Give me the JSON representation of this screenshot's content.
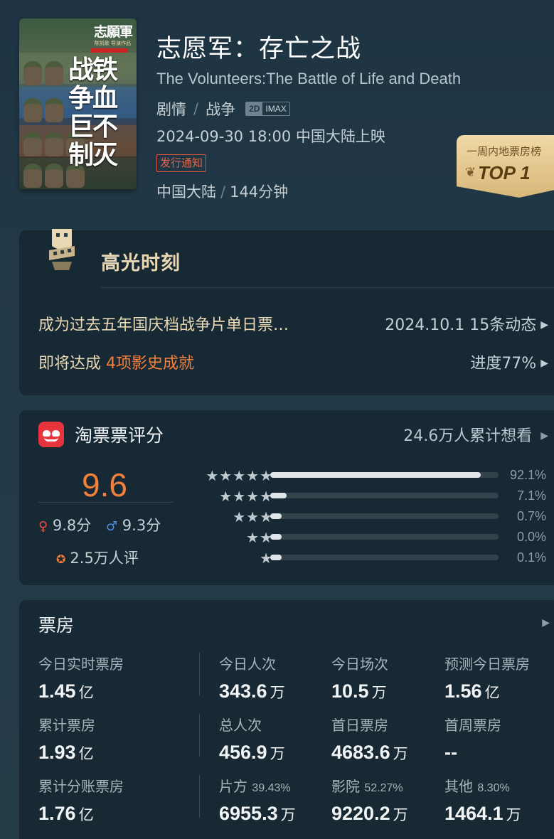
{
  "movie": {
    "poster": {
      "brand": "志願軍",
      "subtitle": "陈凯歌 导演作品",
      "title": "战铁\n争血\n巨不\n制灭"
    },
    "title_cn": "志愿军：存亡之战",
    "title_en": "The Volunteers:The Battle of Life and Death",
    "genres": [
      "剧情",
      "战争"
    ],
    "formats": [
      "2D",
      "IMAX"
    ],
    "release": "2024-09-30 18:00 中国大陆上映",
    "notice_label": "发行通知",
    "region": "中国大陆",
    "duration": "144分钟",
    "rank": {
      "label": "一周内地票房榜",
      "value": "TOP 1"
    }
  },
  "highlights": {
    "title": "高光时刻",
    "row1_text": "成为过去五年国庆档战争片单日票…",
    "row1_date": "2024.10.1",
    "row1_count": "15条动态",
    "row2_prefix": "即将达成",
    "row2_highlight": "4项影史成就",
    "row2_progress": "进度77%"
  },
  "rating": {
    "title": "淘票票评分",
    "want": "24.6万人累计想看",
    "score": "9.6",
    "female_score": "9.8分",
    "male_score": "9.3分",
    "count": "2.5万人评",
    "distribution": [
      {
        "stars": "★★★★★",
        "pct_label": "92.1%",
        "pct": 92.1
      },
      {
        "stars": "★★★★",
        "pct_label": "7.1%",
        "pct": 7.1
      },
      {
        "stars": "★★★",
        "pct_label": "0.7%",
        "pct": 0.7
      },
      {
        "stars": "★★",
        "pct_label": "0.0%",
        "pct": 0.0
      },
      {
        "stars": "★",
        "pct_label": "0.1%",
        "pct": 0.1
      }
    ]
  },
  "box_office": {
    "title": "票房",
    "rows": [
      [
        {
          "label": "今日实时票房",
          "value": "1.45",
          "unit": "亿"
        },
        {
          "label": "今日人次",
          "value": "343.6",
          "unit": "万"
        },
        {
          "label": "今日场次",
          "value": "10.5",
          "unit": "万"
        },
        {
          "label": "预测今日票房",
          "value": "1.56",
          "unit": "亿"
        }
      ],
      [
        {
          "label": "累计票房",
          "value": "1.93",
          "unit": "亿"
        },
        {
          "label": "总人次",
          "value": "456.9",
          "unit": "万"
        },
        {
          "label": "首日票房",
          "value": "4683.6",
          "unit": "万"
        },
        {
          "label": "首周票房",
          "value": "--",
          "unit": ""
        }
      ],
      [
        {
          "label": "累计分账票房",
          "label_pct": "",
          "value": "1.76",
          "unit": "亿"
        },
        {
          "label": "片方",
          "label_pct": "39.43%",
          "value": "6955.3",
          "unit": "万"
        },
        {
          "label": "影院",
          "label_pct": "52.27%",
          "value": "9220.2",
          "unit": "万"
        },
        {
          "label": "其他",
          "label_pct": "8.30%",
          "value": "1464.1",
          "unit": "万"
        }
      ]
    ]
  },
  "colors": {
    "accent_orange": "#f2803a",
    "taopiaopiao_red": "#e8343c",
    "gold": "#e9d8b4"
  }
}
